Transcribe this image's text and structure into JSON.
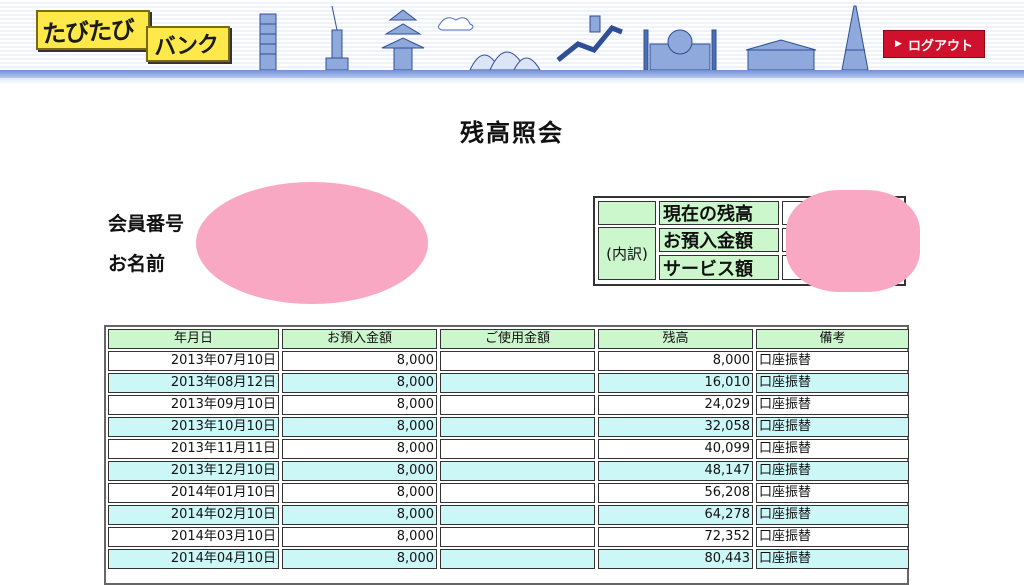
{
  "header": {
    "logo_line1": "たびたび",
    "logo_line2": "バンク",
    "logout_label": "ログアウト",
    "logout_icon": "triangle-right-icon"
  },
  "page": {
    "title": "残高照会"
  },
  "member": {
    "number_label": "会員番号",
    "name_label": "お名前"
  },
  "summary": {
    "naiyaku_label": "(内訳)",
    "current_balance_label": "現在の残高",
    "deposit_total_label": "お預入金額",
    "service_total_label": "サービス額"
  },
  "table": {
    "headers": [
      "年月日",
      "お預入金額",
      "ご使用金額",
      "残高",
      "備考"
    ],
    "rows": [
      {
        "date": "2013年07月10日",
        "deposit": "8,000",
        "used": "",
        "balance": "8,000",
        "note": "口座振替"
      },
      {
        "date": "2013年08月12日",
        "deposit": "8,000",
        "used": "",
        "balance": "16,010",
        "note": "口座振替"
      },
      {
        "date": "2013年09月10日",
        "deposit": "8,000",
        "used": "",
        "balance": "24,029",
        "note": "口座振替"
      },
      {
        "date": "2013年10月10日",
        "deposit": "8,000",
        "used": "",
        "balance": "32,058",
        "note": "口座振替"
      },
      {
        "date": "2013年11月11日",
        "deposit": "8,000",
        "used": "",
        "balance": "40,099",
        "note": "口座振替"
      },
      {
        "date": "2013年12月10日",
        "deposit": "8,000",
        "used": "",
        "balance": "48,147",
        "note": "口座振替"
      },
      {
        "date": "2014年01月10日",
        "deposit": "8,000",
        "used": "",
        "balance": "56,208",
        "note": "口座振替"
      },
      {
        "date": "2014年02月10日",
        "deposit": "8,000",
        "used": "",
        "balance": "64,278",
        "note": "口座振替"
      },
      {
        "date": "2014年03月10日",
        "deposit": "8,000",
        "used": "",
        "balance": "72,352",
        "note": "口座振替"
      },
      {
        "date": "2014年04月10日",
        "deposit": "8,000",
        "used": "",
        "balance": "80,443",
        "note": "口座振替"
      }
    ]
  },
  "colors": {
    "header_green": "#ccf7cc",
    "row_cyan": "#ccf7f7",
    "logout_red": "#d0112b",
    "mosaic_pink": "#f9a8c4"
  }
}
